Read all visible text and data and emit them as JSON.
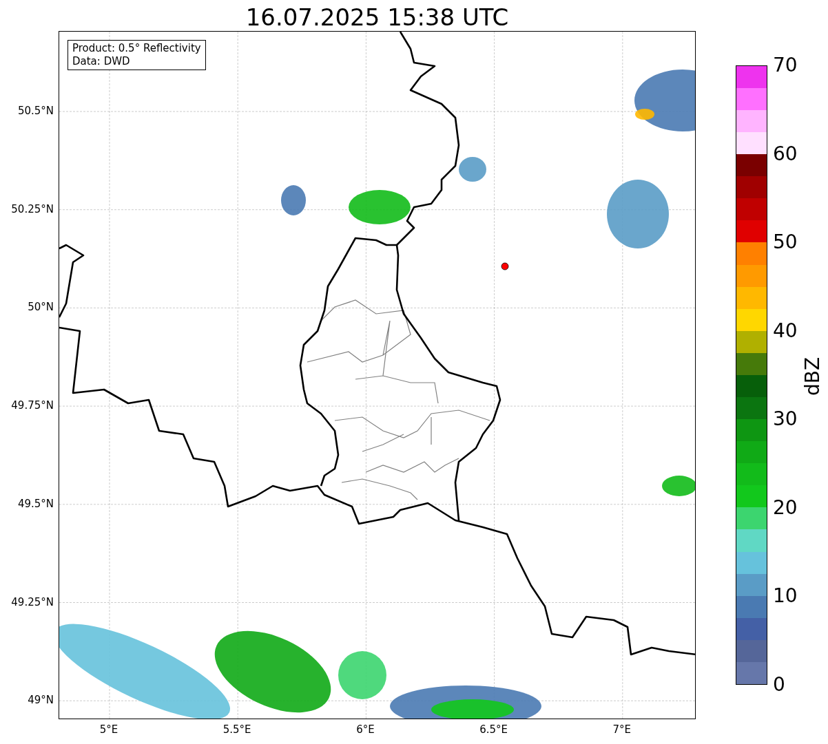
{
  "title": "16.07.2025 15:38 UTC",
  "legend": [
    "Product: 0.5° Reflectivity",
    "Data: DWD"
  ],
  "y_ticks": [
    "50.5°N",
    "50.25°N",
    "50°N",
    "49.75°N",
    "49.5°N",
    "49.25°N",
    "49°N"
  ],
  "x_ticks": [
    "5°E",
    "5.5°E",
    "6°E",
    "6.5°E",
    "7°E"
  ],
  "colorbar": {
    "label": "dBZ",
    "ticks": [
      "70",
      "60",
      "50",
      "40",
      "30",
      "20",
      "10",
      "0"
    ],
    "segments": [
      {
        "color": "#6677aa"
      },
      {
        "color": "#556699"
      },
      {
        "color": "#4460a6"
      },
      {
        "color": "#4a7ab2"
      },
      {
        "color": "#5a9cc6"
      },
      {
        "color": "#66c2dc"
      },
      {
        "color": "#60d8c4"
      },
      {
        "color": "#3cd56f"
      },
      {
        "color": "#12c81c"
      },
      {
        "color": "#12bb1a"
      },
      {
        "color": "#10aa16"
      },
      {
        "color": "#0e9612"
      },
      {
        "color": "#0b7510"
      },
      {
        "color": "#075f0a"
      },
      {
        "color": "#467a0a"
      },
      {
        "color": "#b0b000"
      },
      {
        "color": "#ffd700"
      },
      {
        "color": "#ffb800"
      },
      {
        "color": "#ff9a00"
      },
      {
        "color": "#ff8000"
      },
      {
        "color": "#e00000"
      },
      {
        "color": "#c00000"
      },
      {
        "color": "#a00000"
      },
      {
        "color": "#7a0000"
      },
      {
        "color": "#ffe0ff"
      },
      {
        "color": "#ffb4ff"
      },
      {
        "color": "#ff70ff"
      },
      {
        "color": "#ee33ee"
      }
    ]
  }
}
